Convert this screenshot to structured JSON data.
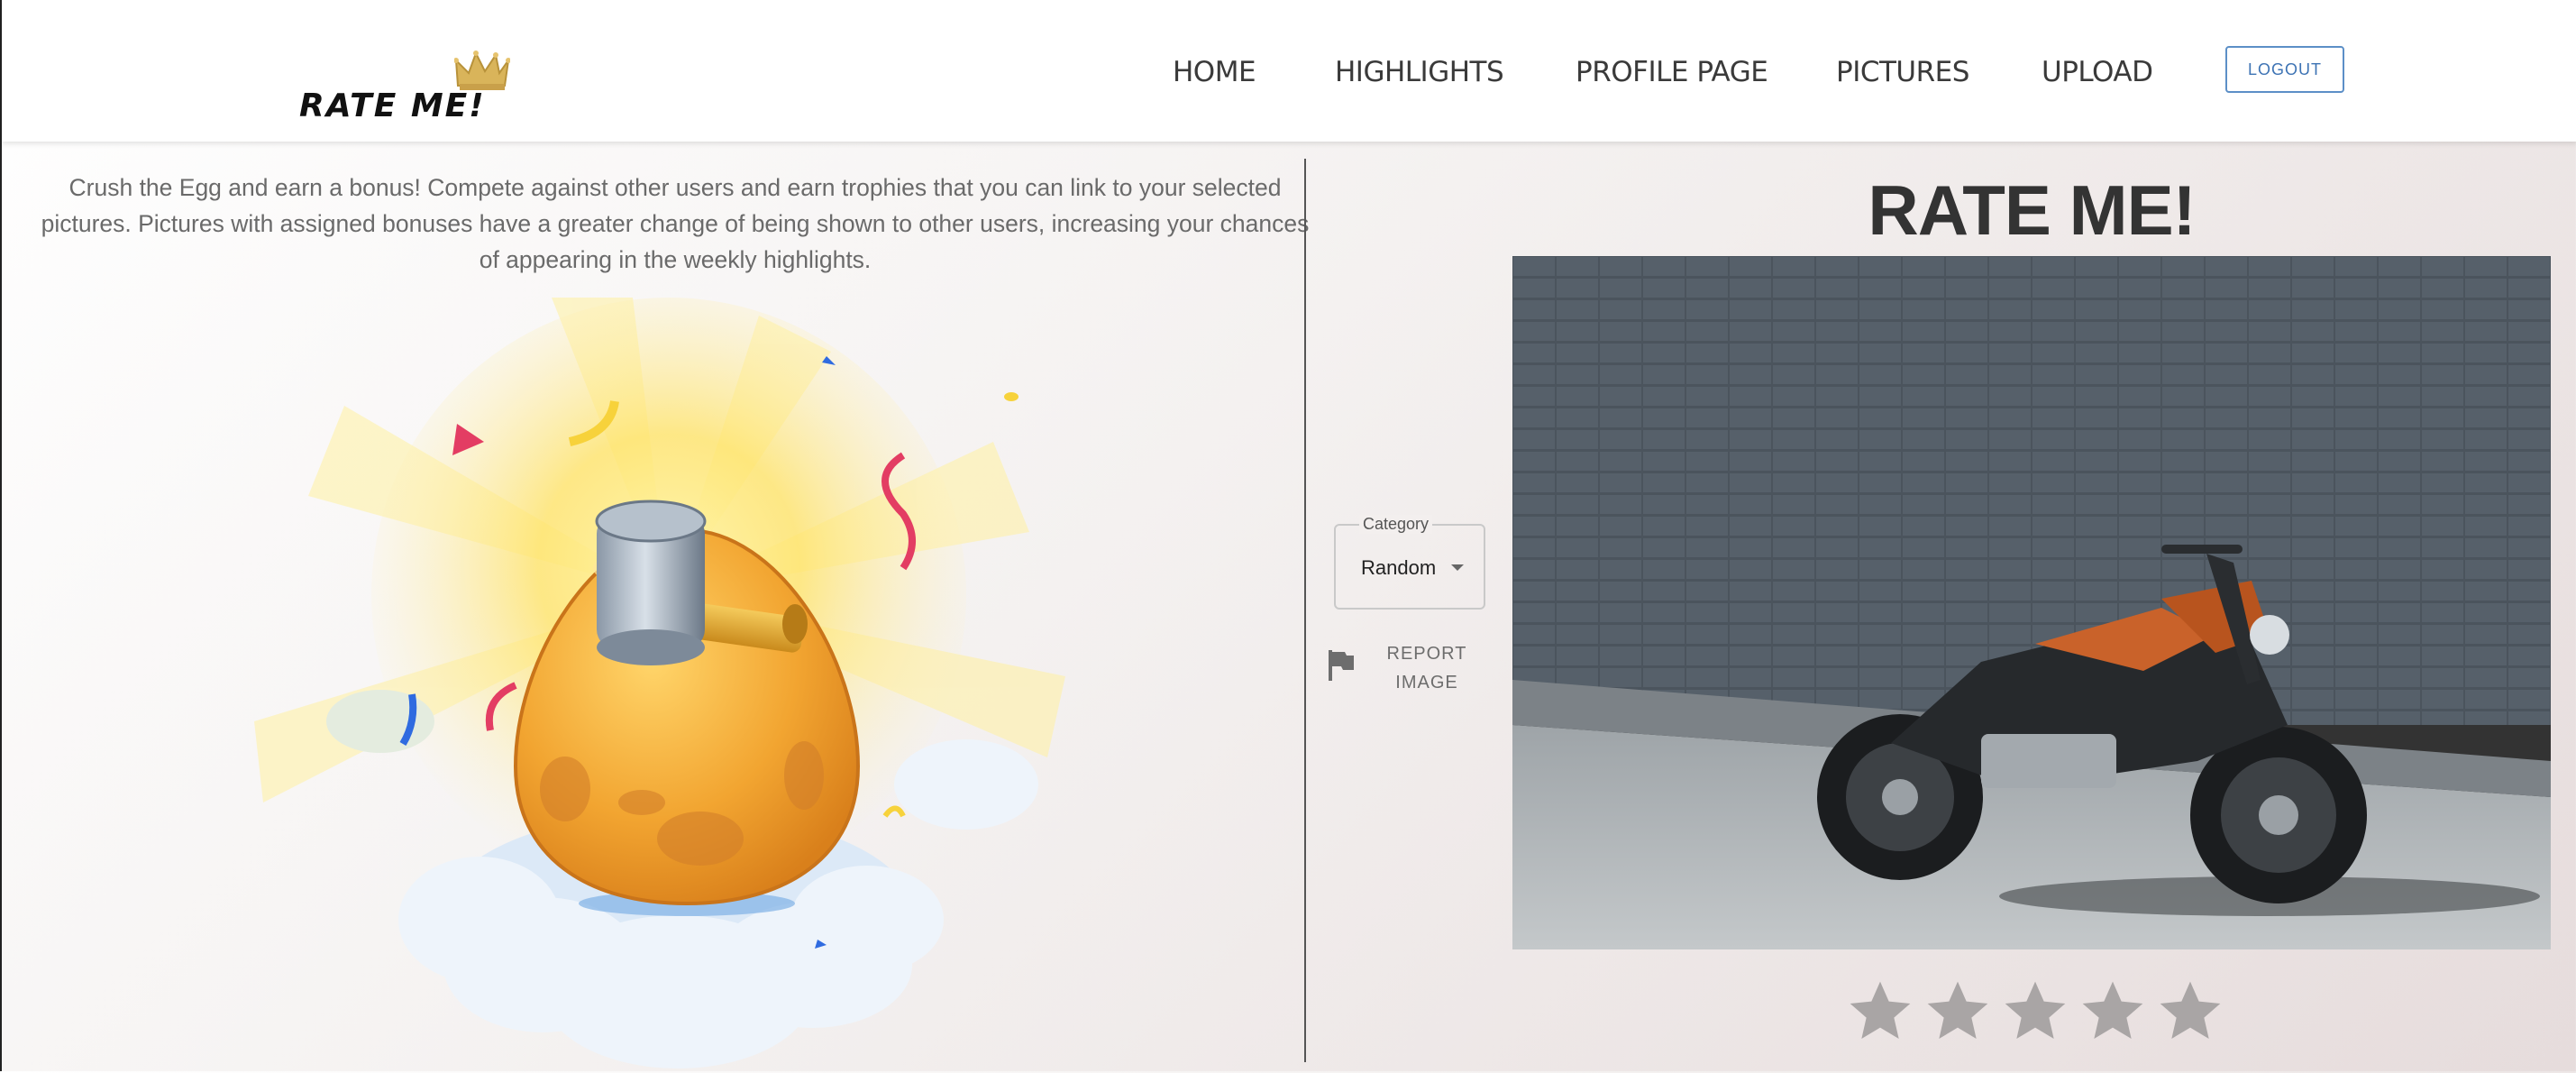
{
  "header": {
    "logo_text": "RATE ME!",
    "nav": [
      {
        "label": "HOME"
      },
      {
        "label": "HIGHLIGHTS"
      },
      {
        "label": "PROFILE PAGE"
      },
      {
        "label": "PICTURES"
      },
      {
        "label": "UPLOAD"
      }
    ],
    "logout_label": "LOGOUT"
  },
  "left": {
    "intro": "Crush the Egg and earn a bonus! Compete against other users and earn trophies that you can link to your selected pictures. Pictures with assigned bonuses have a greater change of being shown to other users, increasing your chances of appearing in the weekly highlights."
  },
  "controls": {
    "category_label": "Category",
    "category_value": "Random",
    "report_line1": "REPORT",
    "report_line2": "IMAGE"
  },
  "right": {
    "title": "RATE ME!",
    "rating": {
      "value": 0,
      "max": 5
    }
  },
  "colors": {
    "accent": "#5c8fc7",
    "star_empty": "#a9a5a5",
    "egg": "#f2a531"
  }
}
